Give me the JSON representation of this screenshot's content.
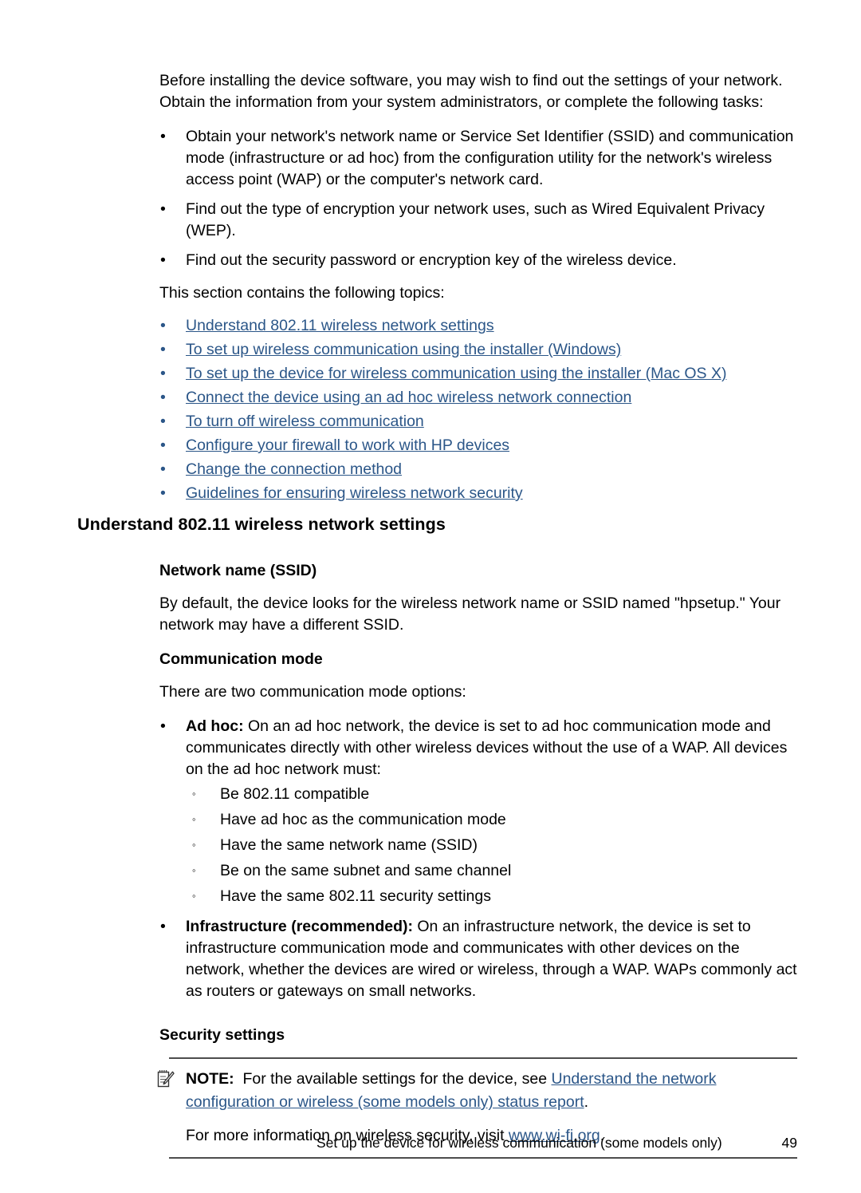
{
  "document": {
    "intro_paragraph": "Before installing the device software, you may wish to find out the settings of your network. Obtain the information from your system administrators, or complete the following tasks:",
    "task_bullets": [
      "Obtain your network's network name or Service Set Identifier (SSID) and communication mode (infrastructure or ad hoc) from the configuration utility for the network's wireless access point (WAP) or the computer's network card.",
      "Find out the type of encryption your network uses, such as Wired Equivalent Privacy (WEP).",
      "Find out the security password or encryption key of the wireless device."
    ],
    "topics_intro": "This section contains the following topics:",
    "topic_links": [
      "Understand 802.11 wireless network settings",
      "To set up wireless communication using the installer (Windows)",
      "To set up the device for wireless communication using the installer (Mac OS X)",
      "Connect the device using an ad hoc wireless network connection",
      "To turn off wireless communication",
      "Configure your firewall to work with HP devices",
      "Change the connection method",
      "Guidelines for ensuring wireless network security"
    ],
    "section_heading": "Understand 802.11 wireless network settings",
    "ssid": {
      "heading": "Network name (SSID)",
      "paragraph": "By default, the device looks for the wireless network name or SSID named \"hpsetup.\" Your network may have a different SSID."
    },
    "communication_mode": {
      "heading": "Communication mode",
      "intro": "There are two communication mode options:",
      "ad_hoc": {
        "label": "Ad hoc:",
        "text": " On an ad hoc network, the device is set to ad hoc communication mode and communicates directly with other wireless devices without the use of a WAP. All devices on the ad hoc network must:",
        "requirements": [
          "Be 802.11 compatible",
          "Have ad hoc as the communication mode",
          "Have the same network name (SSID)",
          "Be on the same subnet and same channel",
          "Have the same 802.11 security settings"
        ]
      },
      "infrastructure": {
        "label": "Infrastructure (recommended):",
        "text": " On an infrastructure network, the device is set to infrastructure communication mode and communicates with other devices on the network, whether the devices are wired or wireless, through a WAP. WAPs commonly act as routers or gateways on small networks."
      }
    },
    "security_settings": {
      "heading": "Security settings",
      "note": {
        "icon": "note-pencil-icon",
        "label": "NOTE:",
        "text_before_link": "For the available settings for the device, see ",
        "link": "Understand the network configuration or wireless (some models only) status report",
        "text_after_link": ".",
        "second_before_link": "For more information on wireless security, visit ",
        "second_link": "www.wi-fi.org",
        "second_after_link": "."
      }
    },
    "footer": {
      "text": "Set up the device for wireless communication (some models only)",
      "page_number": "49"
    },
    "markers": {
      "bullet": "•",
      "sub_bullet": "◦"
    },
    "colors": {
      "link": "#2b5688",
      "rule": "#4d4d4d",
      "text": "#000000"
    }
  }
}
